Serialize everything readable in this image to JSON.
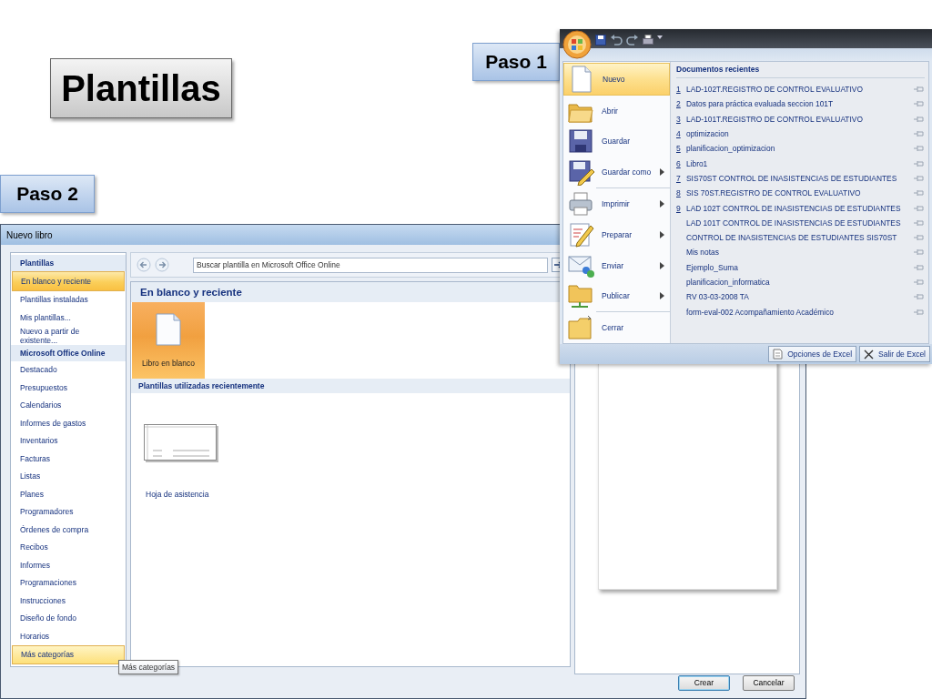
{
  "slide_title": "Plantillas",
  "steps": [
    {
      "label": "Paso 1"
    },
    {
      "label": "Paso 2"
    }
  ],
  "dialog": {
    "title": "Nuevo libro",
    "sidebar": [
      {
        "kind": "header",
        "label": "Plantillas"
      },
      {
        "kind": "item",
        "label": "En blanco y reciente",
        "selected": true,
        "hovered": false
      },
      {
        "kind": "item",
        "label": "Plantillas instaladas",
        "selected": false,
        "hovered": false
      },
      {
        "kind": "item",
        "label": "Mis plantillas...",
        "selected": false,
        "hovered": false
      },
      {
        "kind": "item",
        "label": "Nuevo a partir de existente...",
        "selected": false,
        "hovered": false
      },
      {
        "kind": "header",
        "label": "Microsoft Office Online"
      },
      {
        "kind": "item",
        "label": "Destacado",
        "selected": false,
        "hovered": false
      },
      {
        "kind": "item",
        "label": "Presupuestos",
        "selected": false,
        "hovered": false
      },
      {
        "kind": "item",
        "label": "Calendarios",
        "selected": false,
        "hovered": false
      },
      {
        "kind": "item",
        "label": "Informes de gastos",
        "selected": false,
        "hovered": false
      },
      {
        "kind": "item",
        "label": "Inventarios",
        "selected": false,
        "hovered": false
      },
      {
        "kind": "item",
        "label": "Facturas",
        "selected": false,
        "hovered": false
      },
      {
        "kind": "item",
        "label": "Listas",
        "selected": false,
        "hovered": false
      },
      {
        "kind": "item",
        "label": "Planes",
        "selected": false,
        "hovered": false
      },
      {
        "kind": "item",
        "label": "Programadores",
        "selected": false,
        "hovered": false
      },
      {
        "kind": "item",
        "label": "Órdenes de compra",
        "selected": false,
        "hovered": false
      },
      {
        "kind": "item",
        "label": "Recibos",
        "selected": false,
        "hovered": false
      },
      {
        "kind": "item",
        "label": "Informes",
        "selected": false,
        "hovered": false
      },
      {
        "kind": "item",
        "label": "Programaciones",
        "selected": false,
        "hovered": false
      },
      {
        "kind": "item",
        "label": "Instrucciones",
        "selected": false,
        "hovered": false
      },
      {
        "kind": "item",
        "label": "Diseño de fondo",
        "selected": false,
        "hovered": false
      },
      {
        "kind": "item",
        "label": "Horarios",
        "selected": false,
        "hovered": false
      },
      {
        "kind": "item",
        "label": "Más categorías",
        "selected": false,
        "hovered": true
      }
    ],
    "tooltip": "Más categorías",
    "search": {
      "placeholder": "Buscar plantilla en Microsoft Office Online"
    },
    "section_title": "En blanco y reciente",
    "blank": {
      "label": "Libro en blanco",
      "selected": true
    },
    "recent_title": "Plantillas utilizadas recientemente",
    "recent_templates": [
      {
        "label": "Hoja de asistencia"
      }
    ],
    "buttons": [
      {
        "label": "Crear",
        "default": true
      },
      {
        "label": "Cancelar",
        "default": false
      }
    ]
  },
  "office_menu": {
    "commands": [
      {
        "label": "Nuevo",
        "selected": true,
        "submenu": false,
        "separator_before": false
      },
      {
        "label": "Abrir",
        "selected": false,
        "submenu": false,
        "separator_before": false
      },
      {
        "label": "Guardar",
        "selected": false,
        "submenu": false,
        "separator_before": false
      },
      {
        "label": "Guardar como",
        "selected": false,
        "submenu": true,
        "separator_before": false
      },
      {
        "label": "Imprimir",
        "selected": false,
        "submenu": true,
        "separator_before": true
      },
      {
        "label": "Preparar",
        "selected": false,
        "submenu": true,
        "separator_before": false
      },
      {
        "label": "Enviar",
        "selected": false,
        "submenu": true,
        "separator_before": false
      },
      {
        "label": "Publicar",
        "selected": false,
        "submenu": true,
        "separator_before": false
      },
      {
        "label": "Cerrar",
        "selected": false,
        "submenu": false,
        "separator_before": true
      }
    ],
    "recent_title": "Documentos recientes",
    "recent_documents": [
      {
        "number": "1",
        "name": "LAD-102T.REGISTRO DE CONTROL EVALUATIVO"
      },
      {
        "number": "2",
        "name": "Datos para práctica evaluada seccion 101T"
      },
      {
        "number": "3",
        "name": "LAD-101T.REGISTRO DE CONTROL EVALUATIVO"
      },
      {
        "number": "4",
        "name": "optimizacion"
      },
      {
        "number": "5",
        "name": "planificacion_optimizacion"
      },
      {
        "number": "6",
        "name": "Libro1"
      },
      {
        "number": "7",
        "name": "SIS70ST CONTROL DE INASISTENCIAS DE ESTUDIANTES"
      },
      {
        "number": "8",
        "name": "SIS 70ST.REGISTRO DE CONTROL EVALUATIVO"
      },
      {
        "number": "9",
        "name": "LAD 102T CONTROL DE INASISTENCIAS DE ESTUDIANTES"
      },
      {
        "name": "LAD 101T CONTROL DE INASISTENCIAS DE ESTUDIANTES"
      },
      {
        "name": "CONTROL DE INASISTENCIAS DE ESTUDIANTES SIS70ST"
      },
      {
        "name": "Mis notas"
      },
      {
        "name": "Ejemplo_Suma"
      },
      {
        "name": "planificacion_informatica"
      },
      {
        "name": "RV 03-03-2008 TA"
      },
      {
        "name": "form-eval-002 Acompañamiento Académico"
      }
    ],
    "buttons": [
      {
        "label": "Opciones de Excel",
        "kind": "options"
      },
      {
        "label": "Salir de Excel",
        "kind": "exit"
      }
    ]
  }
}
